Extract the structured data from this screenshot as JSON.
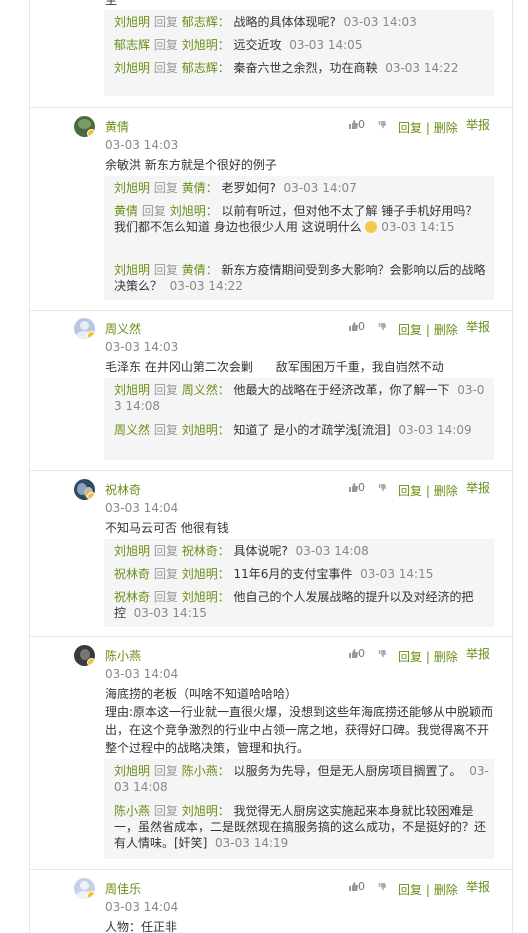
{
  "common": {
    "reply_word": "回复",
    "reply_action": "回复",
    "delete_action": "删除",
    "report_action": "举报",
    "sep": "|"
  },
  "top_fragment": "至",
  "top_replies": [
    {
      "from": "刘旭明",
      "to": "郁志辉：",
      "text": "战略的具体体现呢?",
      "time": "03-03 14:03"
    },
    {
      "from": "郁志辉",
      "to": "刘旭明：",
      "text": "远交近攻",
      "time": "03-03 14:05"
    },
    {
      "from": "刘旭明",
      "to": "郁志辉：",
      "text": "秦奋六世之余烈，功在商鞅",
      "time": "03-03 14:22"
    }
  ],
  "comments": [
    {
      "author": "黄倩",
      "time": "03-03 14:03",
      "votes": "0",
      "avatar_color": "#4a6b3e",
      "content": [
        "余敏洪  新东方就是个很好的例子"
      ],
      "replies": [
        {
          "from": "刘旭明",
          "to": "黄倩：",
          "text": "老罗如何?",
          "time": "03-03 14:07"
        },
        {
          "from": "黄倩",
          "to": "刘旭明：",
          "text": "以前有听过，但对他不太了解 锤子手机好用吗？我们都不怎么知道 身边也很少人用 这说明什么",
          "time": "03-03 14:15",
          "emoji": "thinking-emoji"
        },
        {
          "from": "刘旭明",
          "to": "黄倩：",
          "text": "新东方疫情期间受到多大影响？会影响以后的战略决策么？",
          "time": "03-03 14:22"
        }
      ]
    },
    {
      "author": "周义然",
      "time": "03-03 14:03",
      "votes": "0",
      "avatar_color": "#b9c6e0",
      "content": [
        "毛泽东 在井冈山第二次会剿      敌军围困万千重，我自岿然不动"
      ],
      "replies": [
        {
          "from": "刘旭明",
          "to": "周义然：",
          "text": "他最大的战略在于经济改革，你了解一下",
          "time": "03-03 14:08"
        },
        {
          "from": "周义然",
          "to": "刘旭明：",
          "text": "知道了 是小的才疏学浅[流泪]",
          "time": "03-03 14:09"
        }
      ]
    },
    {
      "author": "祝林奇",
      "time": "03-03 14:04",
      "votes": "0",
      "avatar_color": "#2f4a66",
      "content": [
        "不知马云可否 他很有钱"
      ],
      "replies": [
        {
          "from": "刘旭明",
          "to": "祝林奇：",
          "text": "具体说呢?",
          "time": "03-03 14:08"
        },
        {
          "from": "祝林奇",
          "to": "刘旭明：",
          "text": "11年6月的支付宝事件",
          "time": "03-03 14:15"
        },
        {
          "from": "祝林奇",
          "to": "刘旭明：",
          "text": "他自己的个人发展战略的提升以及对经济的把控",
          "time": "03-03 14:15"
        }
      ]
    },
    {
      "author": "陈小燕",
      "time": "03-03 14:04",
      "votes": "0",
      "avatar_color": "#3a3a3a",
      "content": [
        "海底捞的老板（叫啥不知道哈哈哈）",
        "理由:原本这一行业就一直很火爆，没想到这些年海底捞还能够从中脱颖而",
        "出，在这个竞争激烈的行业中占领一席之地，获得好口碑。我觉得离不开",
        "整个过程中的战略决策，管理和执行。"
      ],
      "replies": [
        {
          "from": "刘旭明",
          "to": "陈小燕：",
          "text": "以服务为先导，但是无人厨房项目搁置了。",
          "time": "03-03 14:08"
        },
        {
          "from": "陈小燕",
          "to": "刘旭明：",
          "text": "我觉得无人厨房这实施起来本身就比较困难是一，虽然省成本，二是既然现在搞服务搞的这么成功，不是挺好的？还有人情味。[奸笑]",
          "time": "03-03 14:19"
        }
      ]
    },
    {
      "author": "周佳乐",
      "time": "03-03 14:04",
      "votes": "0",
      "avatar_color": "#c6cfe6",
      "content": [
        "人物：任正非"
      ],
      "replies": []
    }
  ]
}
